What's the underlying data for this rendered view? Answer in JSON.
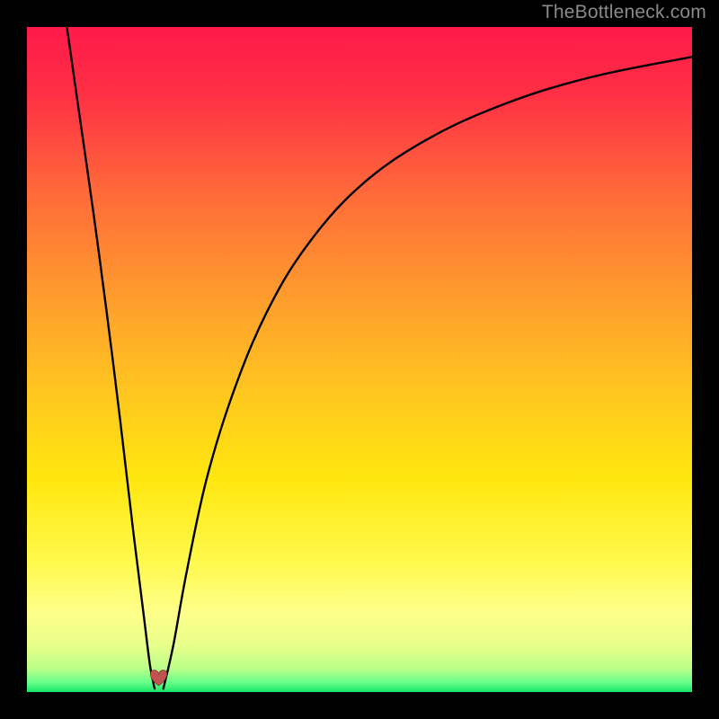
{
  "watermark": "TheBottleneck.com",
  "chart_data": {
    "type": "line",
    "title": "",
    "xlabel": "",
    "ylabel": "",
    "xlim": [
      0,
      100
    ],
    "ylim": [
      0,
      100
    ],
    "gradient_stops": [
      {
        "offset": 0.0,
        "color": "#ff1a49"
      },
      {
        "offset": 0.1,
        "color": "#ff2f45"
      },
      {
        "offset": 0.25,
        "color": "#ff6a3a"
      },
      {
        "offset": 0.4,
        "color": "#ff9a2e"
      },
      {
        "offset": 0.55,
        "color": "#ffc71f"
      },
      {
        "offset": 0.68,
        "color": "#ffe60f"
      },
      {
        "offset": 0.8,
        "color": "#fff94a"
      },
      {
        "offset": 0.88,
        "color": "#ffff8a"
      },
      {
        "offset": 0.93,
        "color": "#e8ff8a"
      },
      {
        "offset": 0.965,
        "color": "#b9ff8a"
      },
      {
        "offset": 0.985,
        "color": "#6aff8a"
      },
      {
        "offset": 1.0,
        "color": "#17e66a"
      }
    ],
    "series": [
      {
        "name": "left-branch",
        "x": [
          6,
          8,
          10,
          12,
          14,
          16,
          17.5,
          18.5,
          19.2
        ],
        "values": [
          100,
          86,
          72,
          57,
          41,
          24,
          12,
          4,
          0.5
        ]
      },
      {
        "name": "right-branch",
        "x": [
          20.5,
          22,
          24,
          27,
          31,
          36,
          42,
          50,
          60,
          72,
          85,
          100
        ],
        "values": [
          0.5,
          7,
          18,
          32,
          45,
          57,
          67,
          76,
          83,
          88.5,
          92.5,
          95.5
        ]
      }
    ],
    "marker": {
      "name": "heart",
      "x": 19.8,
      "y": 1.8,
      "color": "#c0524f",
      "size": 22
    }
  }
}
